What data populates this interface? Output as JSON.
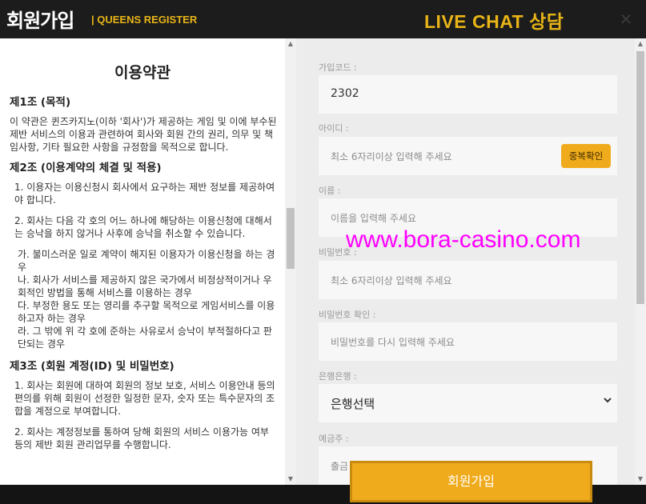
{
  "header": {
    "title": "회원가입",
    "subtitle": "| QUEENS REGISTER",
    "live_chat": "LIVE CHAT 상담",
    "close_symbol": "✕"
  },
  "terms": {
    "title": "이용약관",
    "sections": [
      {
        "heading": "제1조 (목적)",
        "text": "이 약관은 퀸즈카지노(이하 '회사')가 제공하는 게임 및 이에 부수된 제반 서비스의 이용과 관련하여 회사와 회원 간의 권리, 의무 및 책임사항, 기타 필요한 사항을 규정함을 목적으로 합니다."
      },
      {
        "heading": "제2조 (이용계약의 체결 및 적용)",
        "items": [
          "1. 이용자는 이용신청시 회사에서 요구하는 제반 정보를 제공하여야 합니다.",
          "2. 회사는 다음 각 호의 어느 하나에 해당하는 이용신청에 대해서는 승낙을 하지 않거나 사후에 승낙을 취소할 수 있습니다."
        ],
        "subitems": [
          "가. 불미스러운 일로 계약이 해지된 이용자가 이용신청을 하는 경우",
          "나. 회사가 서비스를 제공하지 않은 국가에서 비정상적이거나 우회적인 방법을 통해 서비스를 이용하는 경우",
          "다. 부정한 용도 또는 영리를 추구할 목적으로 게임서비스를 이용하고자 하는 경우",
          "라. 그 밖에 위 각 호에 준하는 사유로서 승낙이 부적절하다고 판단되는 경우"
        ]
      },
      {
        "heading": "제3조 (회원 계정(ID) 및 비밀번호)",
        "items": [
          "1. 회사는 회원에 대하여 회원의 정보 보호, 서비스 이용안내 등의 편의를 위해 회원이 선정한 일정한 문자, 숫자 또는 특수문자의 조합을 계정으로 부여합니다.",
          "2. 회사는 계정정보를 통하여 당해 회원의 서비스 이용가능 여부 등의 제반 회원 관리업무를 수행합니다."
        ]
      }
    ]
  },
  "form": {
    "join_code": {
      "label": "가입코드 :",
      "value": "2302"
    },
    "user_id": {
      "label": "아이디 :",
      "placeholder": "최소 6자리이상 입력해 주세요",
      "dup_button": "중복확인"
    },
    "name": {
      "label": "이름 :",
      "placeholder": "이름을 입력해 주세요"
    },
    "password": {
      "label": "비밀번호 :",
      "placeholder": "최소 6자리이상 입력해 주세요"
    },
    "password_confirm": {
      "label": "비밀번호 확인 :",
      "placeholder": "비밀번호를 다시 입력해 주세요"
    },
    "bank": {
      "label": "은행은행 :",
      "value": "은행선택",
      "chevron": "⌄"
    },
    "holder": {
      "label": "예금주 :",
      "placeholder": "출금"
    }
  },
  "submit_label": "회원가입",
  "watermark": "www.bora-casino.com",
  "scroll_arrows": {
    "up": "▲",
    "down": "▼"
  },
  "icons": {
    "close": "close-icon",
    "chevron": "chevron-down-icon"
  },
  "colors": {
    "header_bg": "#1c1c1c",
    "accent": "#f0ab1c",
    "title_gold": "#e8b417",
    "form_bg": "#ececec",
    "watermark": "#ff00ff"
  }
}
